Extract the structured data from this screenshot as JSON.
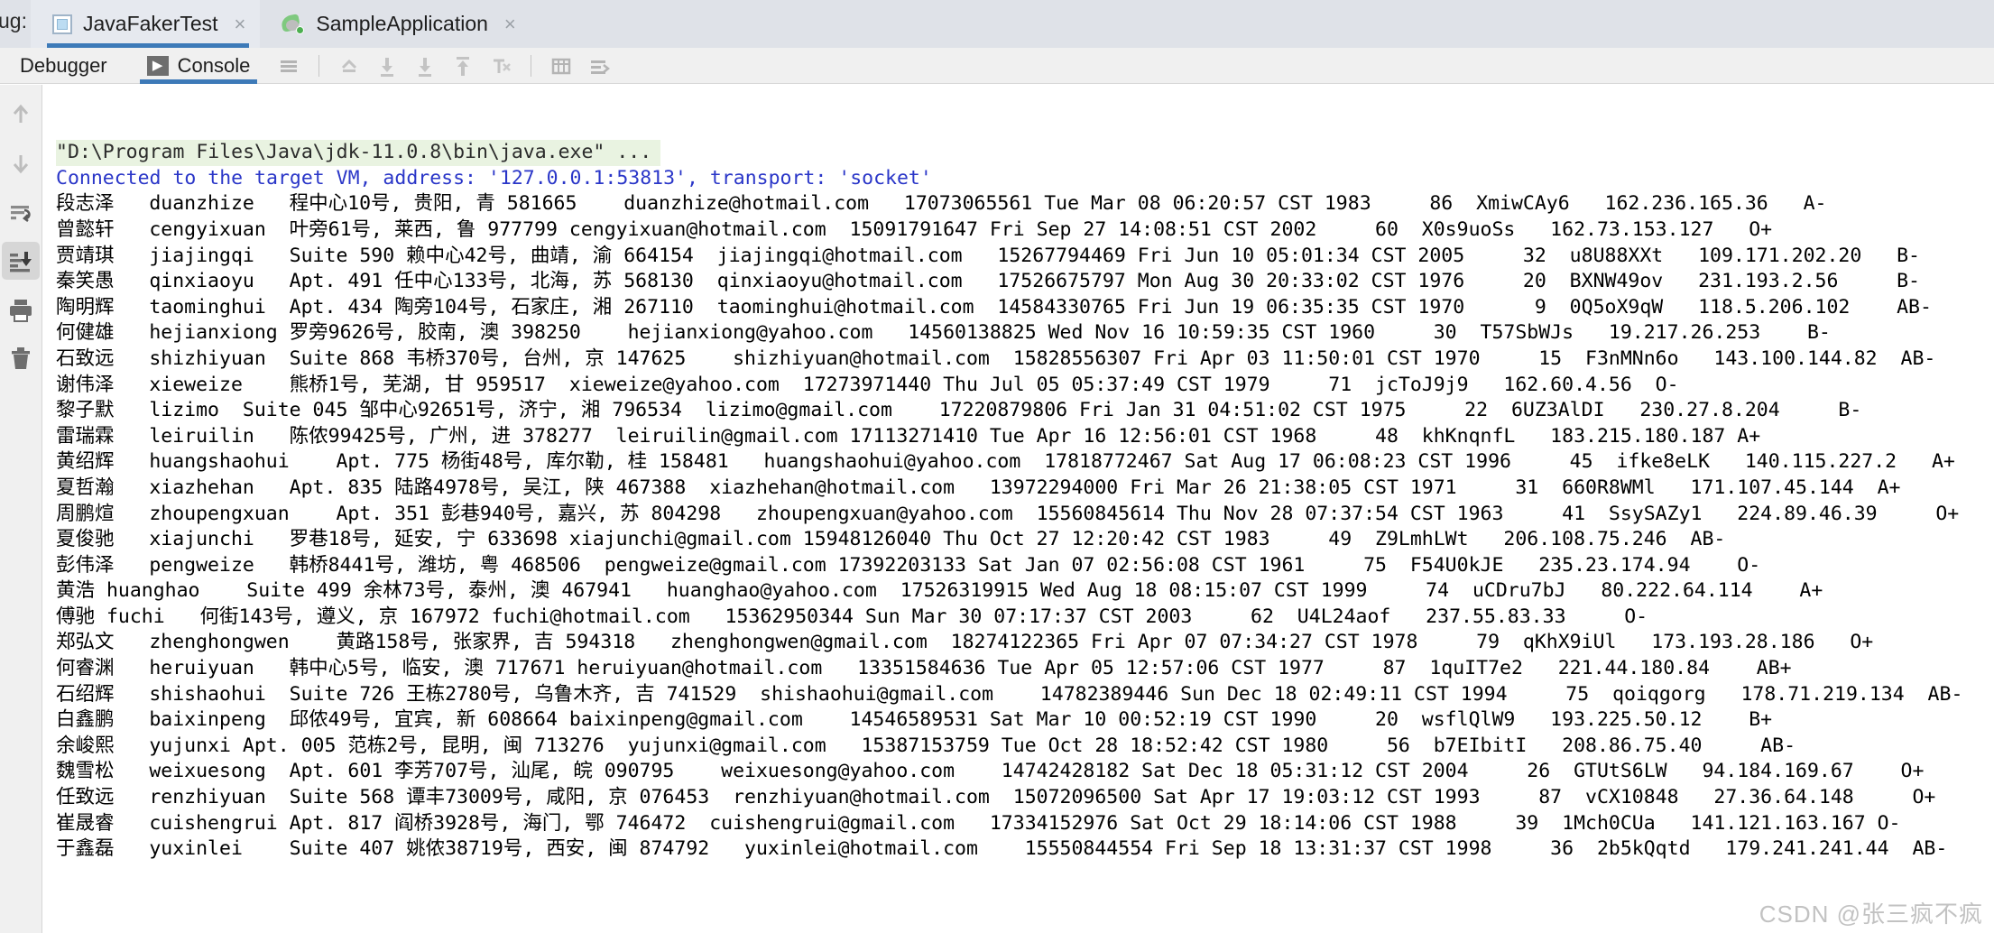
{
  "window": {
    "debug_label": "ug:"
  },
  "tabs": [
    {
      "title": "JavaFakerTest",
      "icon": "junit-icon",
      "active": true,
      "close": "×"
    },
    {
      "title": "SampleApplication",
      "icon": "spring-leaf-icon",
      "active": false,
      "close": "×"
    }
  ],
  "subtabs": [
    {
      "label": "Debugger",
      "active": false,
      "icon": null
    },
    {
      "label": "Console",
      "active": true,
      "icon": "console-play-icon"
    }
  ],
  "toolbar_icons": [
    "soft-wrap-icon",
    "up-to-stack-icon",
    "scroll-down-icon",
    "scroll-to-end-icon",
    "scroll-to-top-icon",
    "clear-text-icon",
    "table-icon",
    "settings-lines-icon"
  ],
  "left_toolbar_icons": [
    {
      "name": "arrow-up-icon",
      "selected": false
    },
    {
      "name": "arrow-down-icon",
      "selected": false
    },
    {
      "name": "soft-wrap-lines-icon",
      "selected": false
    },
    {
      "name": "scroll-to-end-icon",
      "selected": true
    },
    {
      "name": "print-icon",
      "selected": false
    },
    {
      "name": "trash-icon",
      "selected": false
    }
  ],
  "colors": {
    "accent": "#3d7ab8",
    "tabbar_bg": "#dfe2e8",
    "toolbar_bg": "#f0f0f0",
    "console_bg": "#ffffff",
    "command_bg": "#e9f3e1",
    "info_text": "#2a36c8"
  },
  "console": {
    "lines": [
      {
        "type": "cmd",
        "text": "\"D:\\Program Files\\Java\\jdk-11.0.8\\bin\\java.exe\" ..."
      },
      {
        "type": "info",
        "text": "Connected to the target VM, address: '127.0.0.1:53813', transport: 'socket'"
      },
      {
        "type": "row",
        "text": "段志泽   duanzhize   程中心10号, 贵阳, 青 581665    duanzhize@hotmail.com   17073065561 Tue Mar 08 06:20:57 CST 1983     86  XmiwCAy6   162.236.165.36   A-"
      },
      {
        "type": "row",
        "text": "曾懿轩   cengyixuan  叶旁61号, 莱西, 鲁 977799 cengyixuan@hotmail.com  15091791647 Fri Sep 27 14:08:51 CST 2002     60  X0s9uoSs   162.73.153.127   O+"
      },
      {
        "type": "row",
        "text": "贾靖琪   jiajingqi   Suite 590 赖中心42号, 曲靖, 渝 664154  jiajingqi@hotmail.com   15267794469 Fri Jun 10 05:01:34 CST 2005     32  u8U88XXt   109.171.202.20   B-"
      },
      {
        "type": "row",
        "text": "秦笑愚   qinxiaoyu   Apt. 491 任中心133号, 北海, 苏 568130  qinxiaoyu@hotmail.com   17526675797 Mon Aug 30 20:33:02 CST 1976     20  BXNW49ov   231.193.2.56     B-"
      },
      {
        "type": "row",
        "text": "陶明辉   taominghui  Apt. 434 陶旁104号, 石家庄, 湘 267110  taominghui@hotmail.com  14584330765 Fri Jun 19 06:35:35 CST 1970      9  0Q5oX9qW   118.5.206.102    AB-"
      },
      {
        "type": "row",
        "text": "何健雄   hejianxiong 罗旁9626号, 胶南, 澳 398250    hejianxiong@yahoo.com   14560138825 Wed Nov 16 10:59:35 CST 1960     30  T57SbWJs   19.217.26.253    B-"
      },
      {
        "type": "row",
        "text": "石致远   shizhiyuan  Suite 868 韦桥370号, 台州, 京 147625    shizhiyuan@hotmail.com  15828556307 Fri Apr 03 11:50:01 CST 1970     15  F3nMNn6o   143.100.144.82  AB-"
      },
      {
        "type": "row",
        "text": "谢伟泽   xieweize    熊桥1号, 芜湖, 甘 959517  xieweize@yahoo.com  17273971440 Thu Jul 05 05:37:49 CST 1979     71  jcToJ9j9   162.60.4.56  O-"
      },
      {
        "type": "row",
        "text": "黎子默   lizimo  Suite 045 邹中心92651号, 济宁, 湘 796534  lizimo@gmail.com    17220879806 Fri Jan 31 04:51:02 CST 1975     22  6UZ3AlDI   230.27.8.204     B-"
      },
      {
        "type": "row",
        "text": "雷瑞霖   leiruilin   陈侬99425号, 广州, 进 378277  leiruilin@gmail.com 17113271410 Tue Apr 16 12:56:01 CST 1968     48  khKnqnfL   183.215.180.187 A+"
      },
      {
        "type": "row",
        "text": "黄绍辉   huangshaohui    Apt. 775 杨街48号, 库尔勒, 桂 158481   huangshaohui@yahoo.com  17818772467 Sat Aug 17 06:08:23 CST 1996     45  ifke8eLK   140.115.227.2   A+"
      },
      {
        "type": "row",
        "text": "夏哲瀚   xiazhehan   Apt. 835 陆路4978号, 吴江, 陕 467388  xiazhehan@hotmail.com   13972294000 Fri Mar 26 21:38:05 CST 1971     31  660R8WMl   171.107.45.144  A+"
      },
      {
        "type": "row",
        "text": "周鹏煊   zhoupengxuan    Apt. 351 彭巷940号, 嘉兴, 苏 804298   zhoupengxuan@yahoo.com  15560845614 Thu Nov 28 07:37:54 CST 1963     41  SsySAZy1   224.89.46.39     O+"
      },
      {
        "type": "row",
        "text": "夏俊驰   xiajunchi   罗巷18号, 延安, 宁 633698 xiajunchi@gmail.com 15948126040 Thu Oct 27 12:20:42 CST 1983     49  Z9LmhLWt   206.108.75.246  AB-"
      },
      {
        "type": "row",
        "text": "彭伟泽   pengweize   韩桥8441号, 潍坊, 粤 468506  pengweize@gmail.com 17392203133 Sat Jan 07 02:56:08 CST 1961     75  F54U0kJE   235.23.174.94    O-"
      },
      {
        "type": "row",
        "text": "黄浩 huanghao    Suite 499 余林73号, 泰州, 澳 467941   huanghao@yahoo.com  17526319915 Wed Aug 18 08:15:07 CST 1999     74  uCDru7bJ   80.222.64.114    A+"
      },
      {
        "type": "row",
        "text": "傅驰 fuchi   何街143号, 遵义, 京 167972 fuchi@hotmail.com   15362950344 Sun Mar 30 07:17:37 CST 2003     62  U4L24aof   237.55.83.33     O-"
      },
      {
        "type": "row",
        "text": "郑弘文   zhenghongwen    黄路158号, 张家界, 吉 594318   zhenghongwen@gmail.com  18274122365 Fri Apr 07 07:34:27 CST 1978     79  qKhX9iUl   173.193.28.186   O+"
      },
      {
        "type": "row",
        "text": "何睿渊   heruiyuan   韩中心5号, 临安, 澳 717671 heruiyuan@hotmail.com   13351584636 Tue Apr 05 12:57:06 CST 1977     87  1quIT7e2   221.44.180.84    AB+"
      },
      {
        "type": "row",
        "text": "石绍辉   shishaohui  Suite 726 王栋2780号, 乌鲁木齐, 吉 741529  shishaohui@gmail.com    14782389446 Sun Dec 18 02:49:11 CST 1994     75  qoiqgorg   178.71.219.134  AB-"
      },
      {
        "type": "row",
        "text": "白鑫鹏   baixinpeng  邱侬49号, 宜宾, 新 608664 baixinpeng@gmail.com    14546589531 Sat Mar 10 00:52:19 CST 1990     20  wsflQlW9   193.225.50.12    B+"
      },
      {
        "type": "row",
        "text": "余峻熙   yujunxi Apt. 005 范栋2号, 昆明, 闽 713276  yujunxi@gmail.com   15387153759 Tue Oct 28 18:52:42 CST 1980     56  b7EIbitI   208.86.75.40     AB-"
      },
      {
        "type": "row",
        "text": "魏雪松   weixuesong  Apt. 601 李芳707号, 汕尾, 皖 090795    weixuesong@yahoo.com    14742428182 Sat Dec 18 05:31:12 CST 2004     26  GTUtS6LW   94.184.169.67    O+"
      },
      {
        "type": "row",
        "text": "任致远   renzhiyuan  Suite 568 谭丰73009号, 咸阳, 京 076453  renzhiyuan@hotmail.com  15072096500 Sat Apr 17 19:03:12 CST 1993     87  vCX10848   27.36.64.148     O+"
      },
      {
        "type": "row",
        "text": "崔晟睿   cuishengrui Apt. 817 阎桥3928号, 海门, 鄂 746472  cuishengrui@gmail.com   17334152976 Sat Oct 29 18:14:06 CST 1988     39  1Mch0CUa   141.121.163.167 O-"
      },
      {
        "type": "row",
        "text": "于鑫磊   yuxinlei    Suite 407 姚侬38719号, 西安, 闽 874792   yuxinlei@hotmail.com    15550844554 Fri Sep 18 13:31:37 CST 1998     36  2b5kQqtd   179.241.241.44  AB-"
      }
    ]
  },
  "watermark": {
    "text": "CSDN @张三疯不疯"
  }
}
